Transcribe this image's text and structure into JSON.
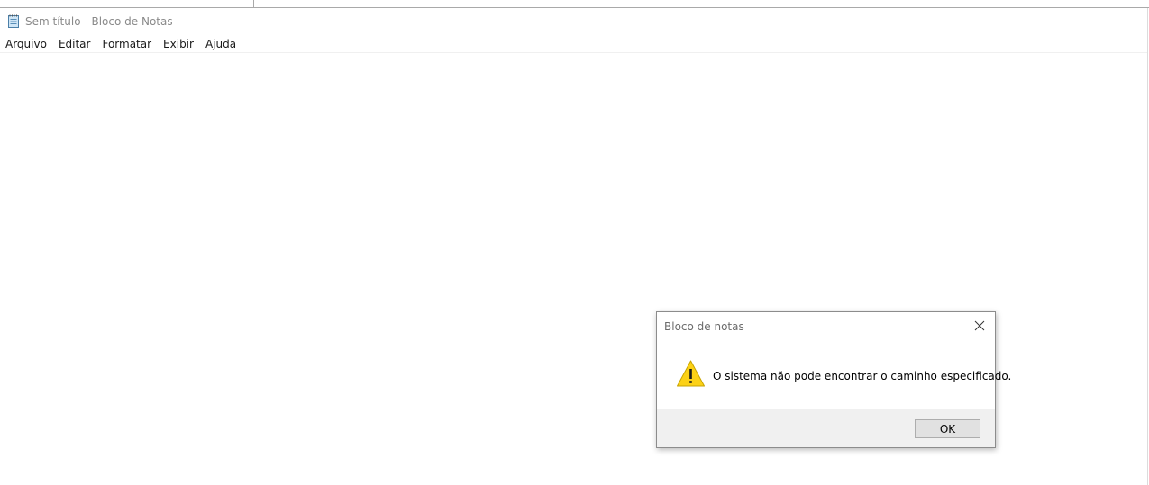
{
  "window": {
    "title": "Sem título - Bloco de Notas",
    "icon": "notepad-icon"
  },
  "menu": {
    "items": [
      {
        "label": "Arquivo"
      },
      {
        "label": "Editar"
      },
      {
        "label": "Formatar"
      },
      {
        "label": "Exibir"
      },
      {
        "label": "Ajuda"
      }
    ]
  },
  "editor": {
    "text": ""
  },
  "dialog": {
    "title": "Bloco de notas",
    "message": "O sistema não pode encontrar o caminho especificado.",
    "icon": "warning-icon",
    "close_icon": "close-icon",
    "ok_label": "OK"
  },
  "colors": {
    "warning_fill": "#fcd116",
    "dialog_footer": "#f0f0f0",
    "button_face": "#e1e1e1",
    "button_border": "#adadad"
  }
}
